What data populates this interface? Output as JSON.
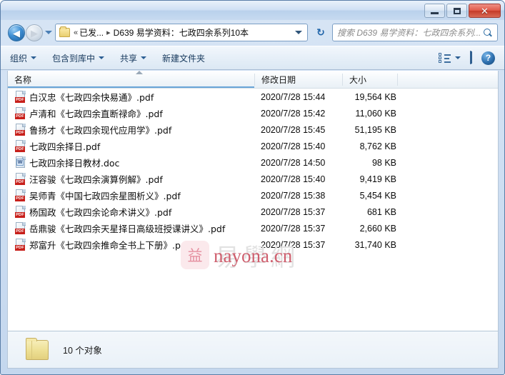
{
  "window": {
    "controls": {
      "minimize_label": "–",
      "maximize_label": "",
      "close_label": "✕"
    }
  },
  "address_bar": {
    "back_glyph": "◀",
    "forward_glyph": "▶",
    "chevron": "«",
    "crumb_1": "已发...",
    "crumb_sep": "▸",
    "crumb_2": "D639 易学资料：七政四余系列10本",
    "refresh_glyph": "↻"
  },
  "search": {
    "placeholder": "搜索 D639 易学资料：七政四余系列..."
  },
  "toolbar": {
    "organize_label": "组织",
    "include_library_label": "包含到库中",
    "share_label": "共享",
    "new_folder_label": "新建文件夹",
    "help_glyph": "?"
  },
  "columns": {
    "name": "名称",
    "date_modified": "修改日期",
    "size": "大小"
  },
  "files": [
    {
      "icon": "pdf-file-icon",
      "badge": "PDF",
      "name": "白汉忠《七政四余快易通》.pdf",
      "date": "2020/7/28 15:44",
      "size": "19,564 KB"
    },
    {
      "icon": "pdf-file-icon",
      "badge": "PDF",
      "name": "卢清和《七政四余直断禄命》.pdf",
      "date": "2020/7/28 15:42",
      "size": "11,060 KB"
    },
    {
      "icon": "pdf-file-icon",
      "badge": "PDF",
      "name": "鲁扬才《七政四余现代应用学》.pdf",
      "date": "2020/7/28 15:45",
      "size": "51,195 KB"
    },
    {
      "icon": "pdf-file-icon",
      "badge": "PDF",
      "name": "七政四余择日.pdf",
      "date": "2020/7/28 15:40",
      "size": "8,762 KB"
    },
    {
      "icon": "doc-file-icon",
      "badge": "W",
      "name": "七政四余择日教材.doc",
      "date": "2020/7/28 14:50",
      "size": "98 KB"
    },
    {
      "icon": "pdf-file-icon",
      "badge": "PDF",
      "name": "汪容骏《七政四余演算例解》.pdf",
      "date": "2020/7/28 15:40",
      "size": "9,419 KB"
    },
    {
      "icon": "pdf-file-icon",
      "badge": "PDF",
      "name": "吴师青《中国七政四余星图析义》.pdf",
      "date": "2020/7/28 15:38",
      "size": "5,454 KB"
    },
    {
      "icon": "pdf-file-icon",
      "badge": "PDF",
      "name": "杨国政《七政四余论命术讲义》.pdf",
      "date": "2020/7/28 15:37",
      "size": "681 KB"
    },
    {
      "icon": "pdf-file-icon",
      "badge": "PDF",
      "name": "岳鼎骏《七政四余天星择日高级班授课讲义》.pdf",
      "date": "2020/7/28 15:37",
      "size": "2,660 KB"
    },
    {
      "icon": "pdf-file-icon",
      "badge": "PDF",
      "name": "郑富升《七政四余推命全书上下册》.pdf",
      "date": "2020/7/28 15:37",
      "size": "31,740 KB"
    }
  ],
  "watermark": {
    "cjk": "易學網",
    "logo_glyph": "益",
    "text": "nayona.cn"
  },
  "status": {
    "item_count_label": "10 个对象"
  },
  "colors": {
    "accent_blue": "#2d6fae",
    "pdf_red": "#c7201b",
    "watermark_red": "#cf5f6e",
    "folder_yellow": "#eddf93",
    "close_red": "#c43a28"
  }
}
